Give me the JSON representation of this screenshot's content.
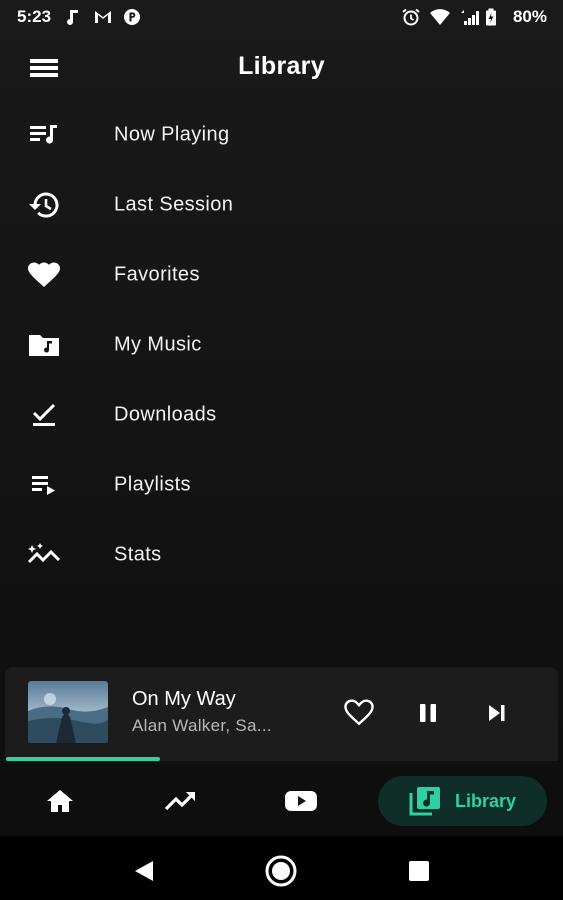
{
  "status_bar": {
    "time": "5:23",
    "battery": "80%",
    "left_icons": [
      "music-note-icon",
      "gmail-icon",
      "p-app-icon"
    ],
    "right_icons": [
      "alarm-icon",
      "wifi-icon",
      "signal-icon",
      "battery-icon"
    ]
  },
  "header": {
    "title": "Library"
  },
  "library": {
    "items": [
      {
        "label": "Now Playing",
        "icon": "queue-music-icon"
      },
      {
        "label": "Last Session",
        "icon": "history-icon"
      },
      {
        "label": "Favorites",
        "icon": "heart-icon"
      },
      {
        "label": "My Music",
        "icon": "music-folder-icon"
      },
      {
        "label": "Downloads",
        "icon": "download-done-icon"
      },
      {
        "label": "Playlists",
        "icon": "playlist-play-icon"
      },
      {
        "label": "Stats",
        "icon": "stats-icon"
      }
    ]
  },
  "mini_player": {
    "title": "On My Way",
    "artist": "Alan Walker, Sa...",
    "progress": 0.28
  },
  "bottom_nav": {
    "items": [
      {
        "name": "home",
        "icon": "home-icon"
      },
      {
        "name": "trending",
        "icon": "trending-icon"
      },
      {
        "name": "youtube",
        "icon": "youtube-icon"
      },
      {
        "name": "library",
        "icon": "library-music-icon",
        "label": "Library",
        "active": true
      }
    ]
  },
  "colors": {
    "accent": "#2ed0a4",
    "background": "#141414",
    "active_pill": "#0f2e27"
  }
}
